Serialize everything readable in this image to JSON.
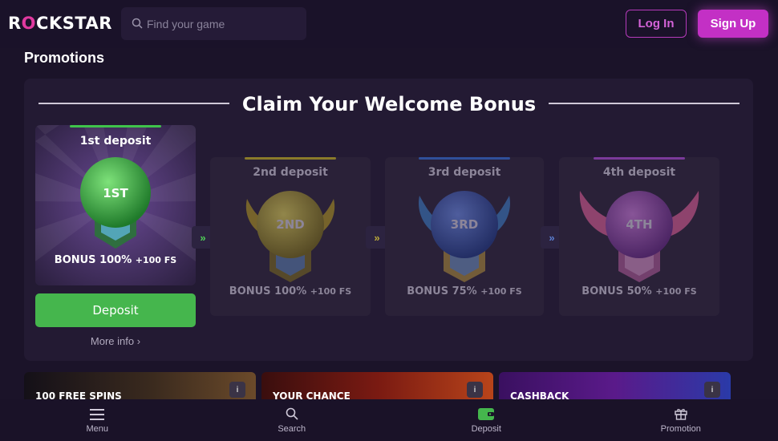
{
  "brand": {
    "logo_pre": "R",
    "logo_o": "O",
    "logo_post": "CKSTAR"
  },
  "header": {
    "search_placeholder": "Find your game",
    "login_label": "Log In",
    "signup_label": "Sign Up"
  },
  "promotions": {
    "title": "Promotions",
    "heading": "Claim Your Welcome Bonus",
    "cards": [
      {
        "label": "1st deposit",
        "rank": "1ST",
        "bonus": "BONUS 100%",
        "fs": "+100 FS",
        "color": "#3fc44b"
      },
      {
        "label": "2nd deposit",
        "rank": "2ND",
        "bonus": "BONUS 100%",
        "fs": "+100 FS",
        "color": "#c2b22f"
      },
      {
        "label": "3rd deposit",
        "rank": "3RD",
        "bonus": "BONUS 75%",
        "fs": "+100 FS",
        "color": "#3560c9"
      },
      {
        "label": "4th deposit",
        "rank": "4TH",
        "bonus": "BONUS 50%",
        "fs": "+100 FS",
        "color": "#a84cc7"
      }
    ],
    "arrow_glyph": "»",
    "deposit_label": "Deposit",
    "more_info_label": "More info ›"
  },
  "tiles": [
    {
      "title": "100 FREE SPINS",
      "info": "i"
    },
    {
      "title": "YOUR CHANCE",
      "info": "i"
    },
    {
      "title": "CASHBACK",
      "info": "i"
    }
  ],
  "bottom_nav": [
    {
      "label": "Menu",
      "icon": "menu-icon"
    },
    {
      "label": "Search",
      "icon": "search-icon"
    },
    {
      "label": "Deposit",
      "icon": "wallet-icon"
    },
    {
      "label": "Promotion",
      "icon": "gift-icon"
    }
  ]
}
